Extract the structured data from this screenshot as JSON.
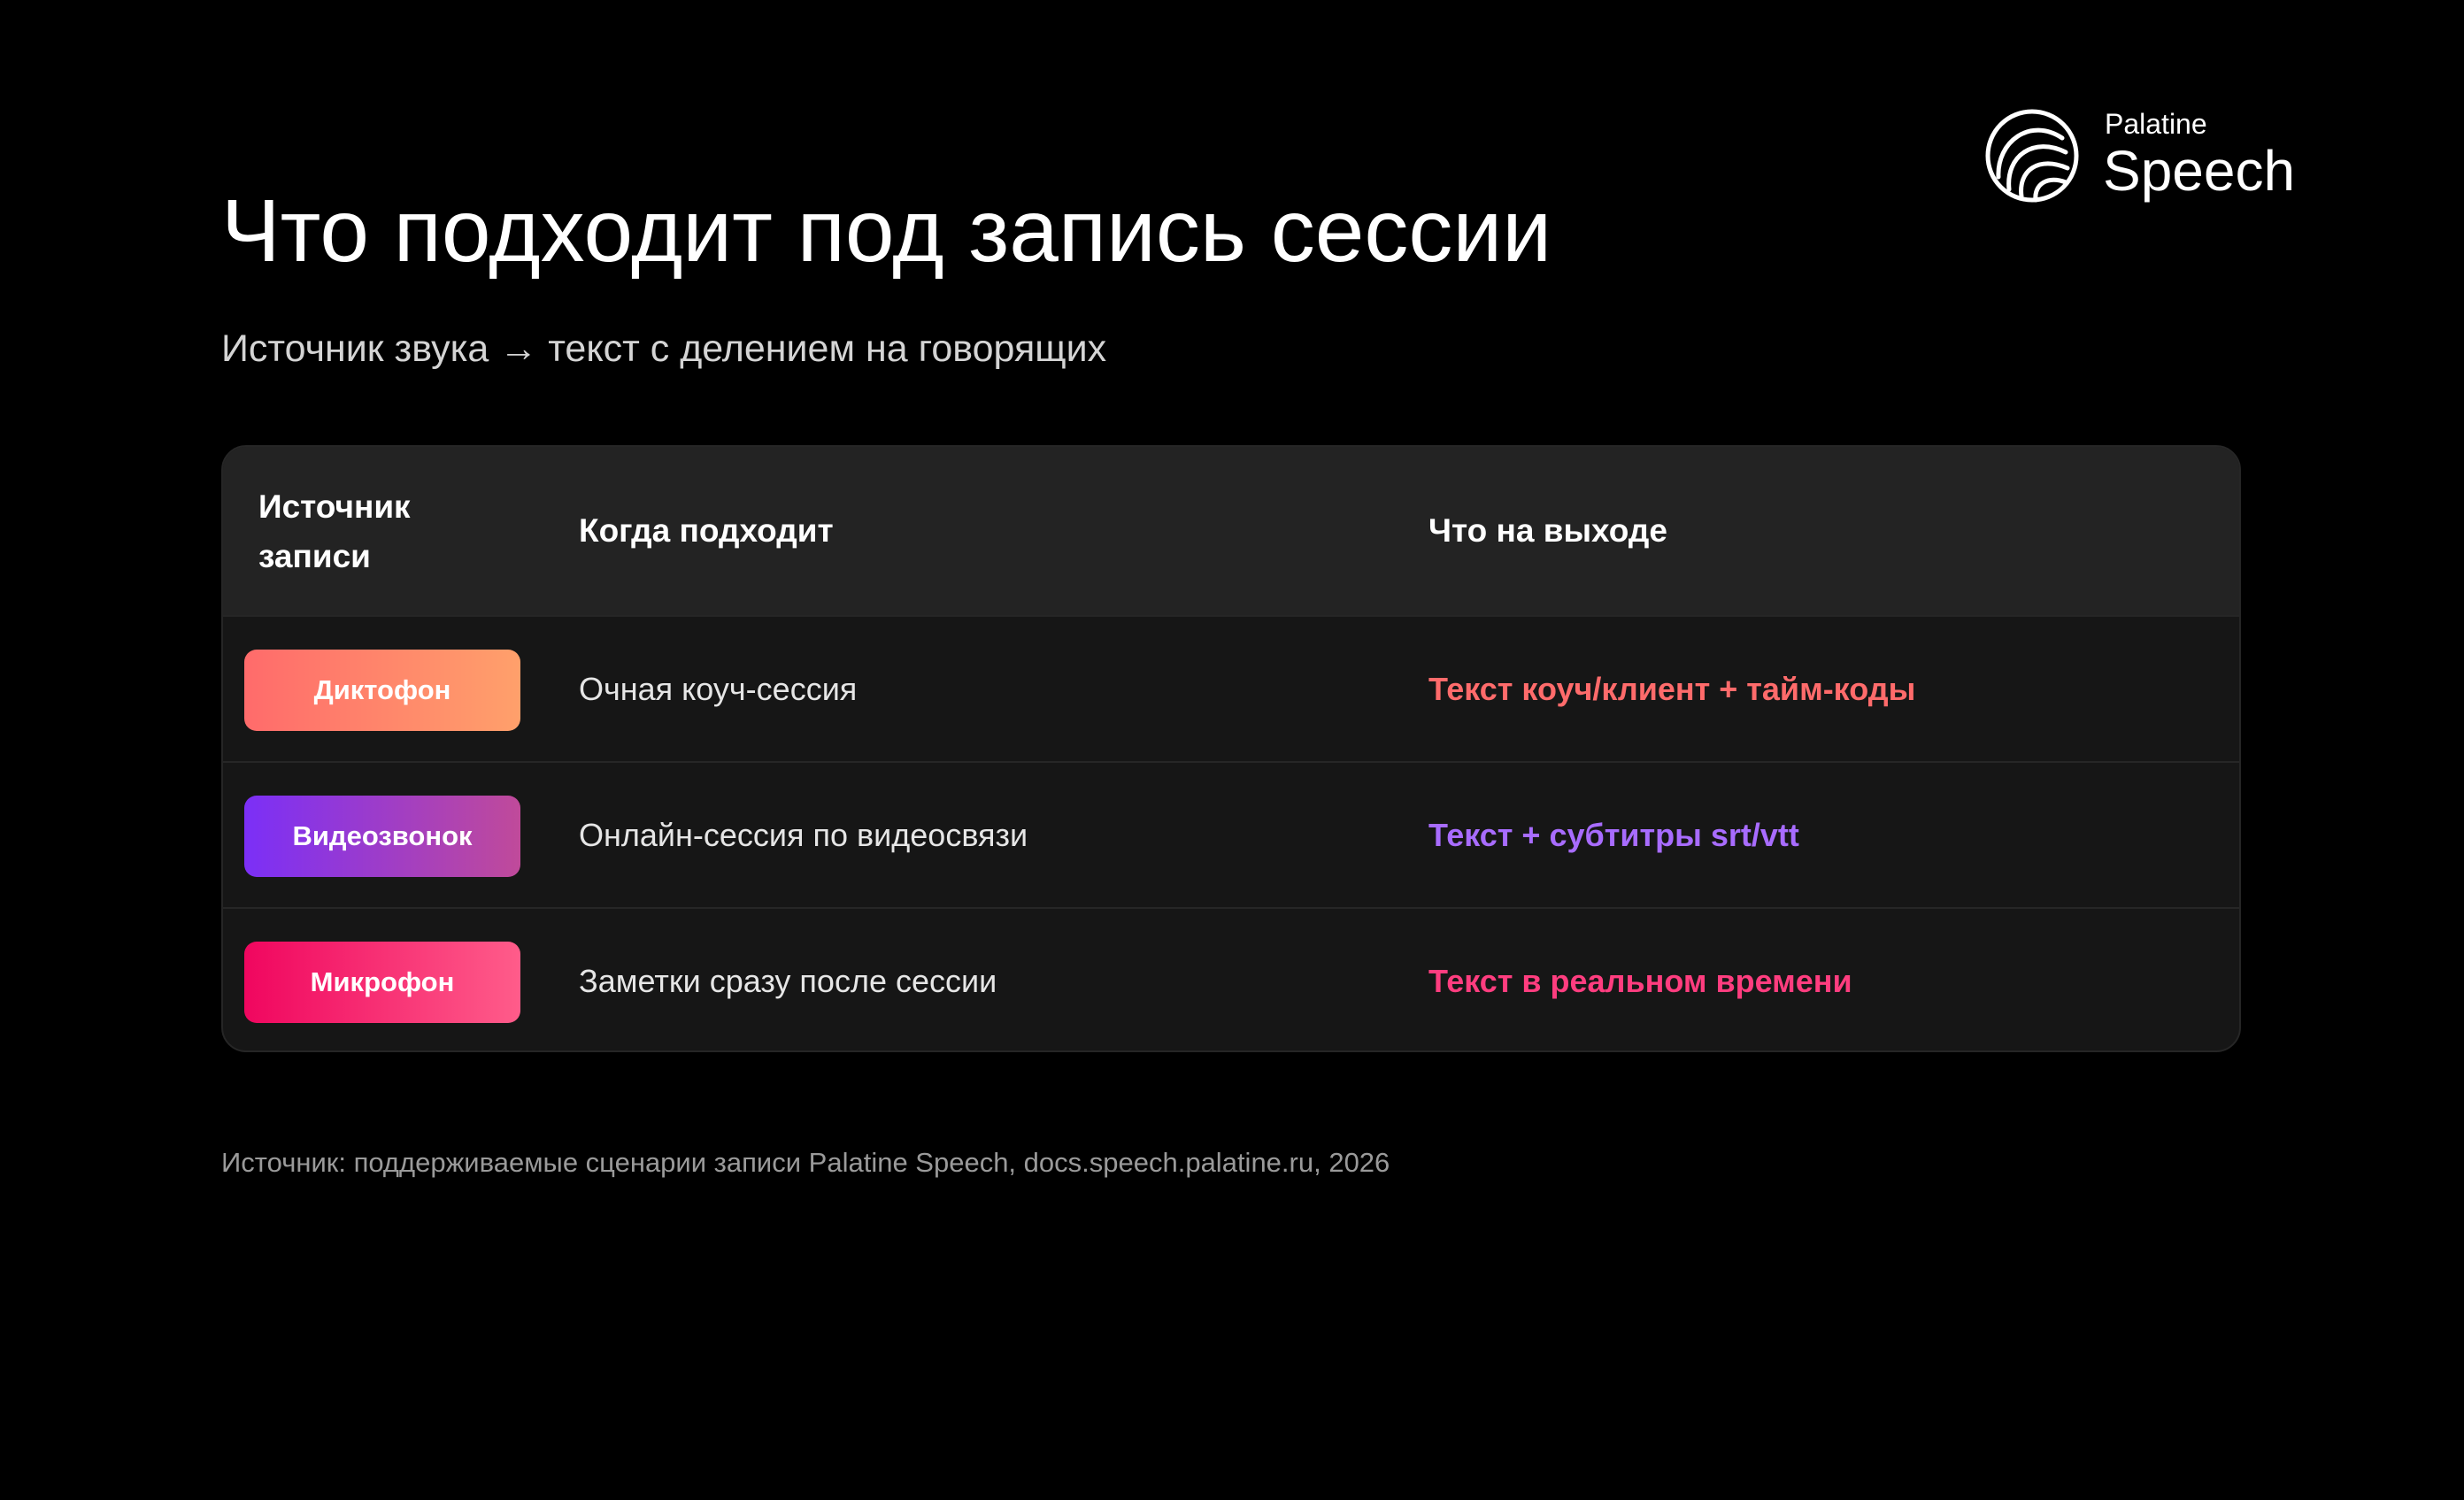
{
  "logo": {
    "small": "Palatine",
    "big": "Speech",
    "icon": "palatine-speech-logo"
  },
  "title": "Что подходит под запись сессии",
  "subtitle": "Источник звука → текст с делением на говорящих",
  "table": {
    "headers": {
      "source": "Источник записи",
      "when": "Когда подходит",
      "output": "Что на выходе"
    },
    "rows": [
      {
        "source": "Диктофон",
        "when": "Очная коуч-сессия",
        "output": "Текст коуч/клиент + тайм-коды",
        "accent": "#ff6b6b"
      },
      {
        "source": "Видеозвонок",
        "when": "Онлайн-сессия по видеосвязи",
        "output": "Текст + субтитры srt/vtt",
        "accent": "#a86cff"
      },
      {
        "source": "Микрофон",
        "when": "Заметки сразу после сессии",
        "output": "Текст в реальном времени",
        "accent": "#ff3d7f"
      }
    ]
  },
  "footnote": "Источник: поддерживаемые сценарии записи Palatine Speech, docs.speech.palatine.ru, 2026"
}
